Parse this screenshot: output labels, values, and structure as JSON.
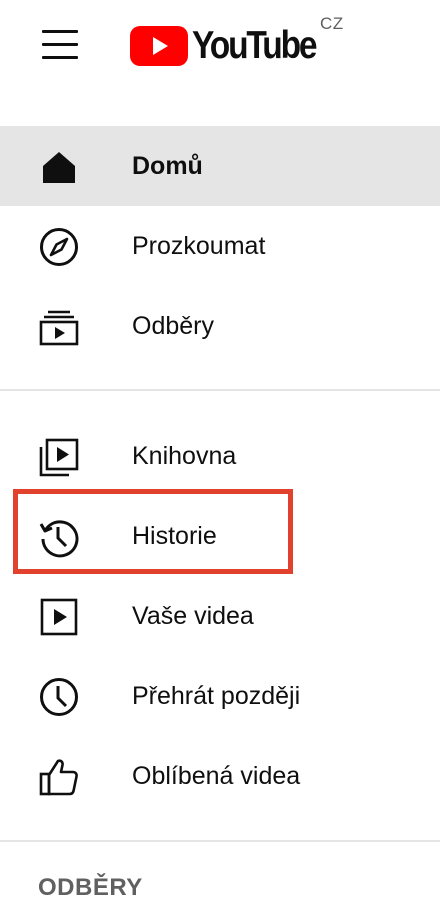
{
  "header": {
    "logo_text": "YouTube",
    "region": "CZ",
    "brand_red": "#ff0000"
  },
  "nav": {
    "main": [
      {
        "label": "Domů",
        "icon": "home-icon",
        "active": true
      },
      {
        "label": "Prozkoumat",
        "icon": "explore-compass-icon",
        "active": false
      },
      {
        "label": "Odběry",
        "icon": "subscriptions-icon",
        "active": false
      }
    ],
    "library": [
      {
        "label": "Knihovna",
        "icon": "library-icon"
      },
      {
        "label": "Historie",
        "icon": "history-icon"
      },
      {
        "label": "Vaše videa",
        "icon": "your-videos-icon"
      },
      {
        "label": "Přehrát později",
        "icon": "watch-later-icon"
      },
      {
        "label": "Oblíbená videa",
        "icon": "liked-videos-icon"
      }
    ]
  },
  "sections": {
    "subscriptions_title": "ODBĚRY"
  },
  "annotation": {
    "highlight_color": "#e2412d",
    "highlighted_item": "Historie"
  }
}
